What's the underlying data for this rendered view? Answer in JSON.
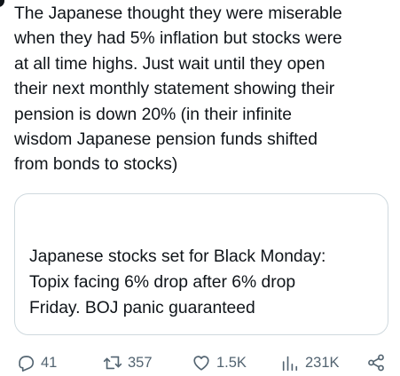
{
  "tweet": {
    "text_lines": [
      "The Japanese thought they were miserable",
      "when they had 5% inflation but stocks were",
      "at all time highs. Just wait until they open",
      "their next monthly statement showing their",
      "pension is down 20% (in their infinite",
      "wisdom Japanese pension funds shifted",
      "from bonds to stocks)"
    ]
  },
  "quote": {
    "text_lines": [
      "Japanese stocks set for Black Monday:",
      "Topix facing 6% drop after 6% drop",
      "Friday. BOJ panic guaranteed"
    ]
  },
  "actions": {
    "reply": {
      "icon": "reply-icon",
      "count": "41"
    },
    "retweet": {
      "icon": "retweet-icon",
      "count": "357"
    },
    "like": {
      "icon": "heart-icon",
      "count": "1.5K"
    },
    "views": {
      "icon": "views-icon",
      "count": "231K"
    },
    "share": {
      "icon": "share-icon"
    }
  },
  "colors": {
    "text": "#0f1419",
    "secondary": "#536471",
    "border": "#cfd9de",
    "background": "#ffffff"
  }
}
